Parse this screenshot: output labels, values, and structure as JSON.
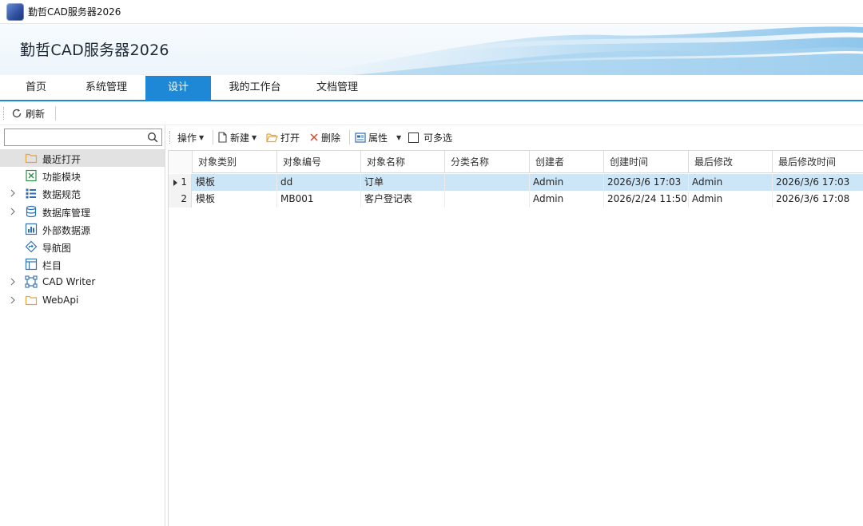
{
  "window": {
    "title": "勤哲CAD服务器2026"
  },
  "banner": {
    "title": "勤哲CAD服务器2026"
  },
  "tabs": [
    {
      "label": "首页",
      "active": false
    },
    {
      "label": "系统管理",
      "active": false
    },
    {
      "label": "设计",
      "active": true
    },
    {
      "label": "我的工作台",
      "active": false
    },
    {
      "label": "文档管理",
      "active": false
    }
  ],
  "toolbar_top": {
    "refresh_label": "刷新"
  },
  "left_panel": {
    "search_placeholder": "",
    "tree": [
      {
        "label": "最近打开",
        "icon": "folder-icon",
        "expandable": false,
        "selected": true
      },
      {
        "label": "功能模块",
        "icon": "excel-icon",
        "expandable": false,
        "selected": false
      },
      {
        "label": "数据规范",
        "icon": "list-icon",
        "expandable": true,
        "selected": false
      },
      {
        "label": "数据库管理",
        "icon": "database-icon",
        "expandable": true,
        "selected": false
      },
      {
        "label": "外部数据源",
        "icon": "chart-icon",
        "expandable": false,
        "selected": false
      },
      {
        "label": "导航图",
        "icon": "navigation-icon",
        "expandable": false,
        "selected": false
      },
      {
        "label": "栏目",
        "icon": "layout-icon",
        "expandable": false,
        "selected": false
      },
      {
        "label": "CAD Writer",
        "icon": "frame-icon",
        "expandable": true,
        "selected": false
      },
      {
        "label": "WebApi",
        "icon": "folder-icon",
        "expandable": true,
        "selected": false
      }
    ]
  },
  "toolbar_grid": {
    "operate_label": "操作",
    "new_label": "新建",
    "open_label": "打开",
    "delete_label": "删除",
    "properties_label": "属性",
    "multiselect_label": "可多选",
    "multiselect_checked": false
  },
  "grid": {
    "columns": [
      "对象类别",
      "对象编号",
      "对象名称",
      "分类名称",
      "创建者",
      "创建时间",
      "最后修改",
      "最后修改时间"
    ],
    "rows": [
      {
        "index": "1",
        "selected": true,
        "cells": [
          "模板",
          "dd",
          "订单",
          "",
          "Admin",
          "2026/3/6 17:03",
          "Admin",
          "2026/3/6 17:03"
        ]
      },
      {
        "index": "2",
        "selected": false,
        "cells": [
          "模板",
          "MB001",
          "客户登记表",
          "",
          "Admin",
          "2026/2/24 11:50",
          "Admin",
          "2026/3/6 17:08"
        ]
      }
    ]
  },
  "colors": {
    "accent": "#1e88d6",
    "selected_row": "#cde6f7",
    "tree_selected": "#e2e2e2",
    "folder": "#e8a33c",
    "delete": "#d9452f"
  }
}
